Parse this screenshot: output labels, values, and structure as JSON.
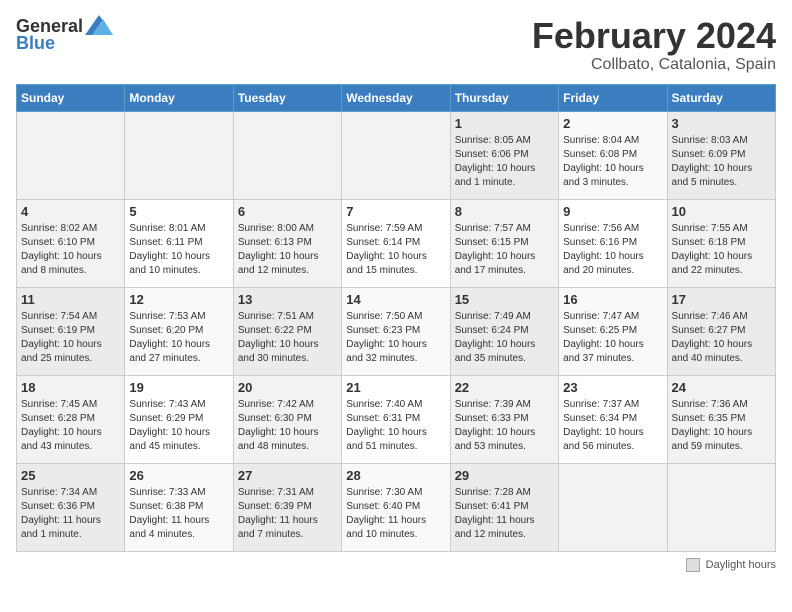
{
  "header": {
    "logo_general": "General",
    "logo_blue": "Blue",
    "month_title": "February 2024",
    "location": "Collbato, Catalonia, Spain"
  },
  "days_of_week": [
    "Sunday",
    "Monday",
    "Tuesday",
    "Wednesday",
    "Thursday",
    "Friday",
    "Saturday"
  ],
  "legend": {
    "label": "Daylight hours"
  },
  "weeks": [
    [
      {
        "day": "",
        "info": ""
      },
      {
        "day": "",
        "info": ""
      },
      {
        "day": "",
        "info": ""
      },
      {
        "day": "",
        "info": ""
      },
      {
        "day": "1",
        "info": "Sunrise: 8:05 AM\nSunset: 6:06 PM\nDaylight: 10 hours\nand 1 minute."
      },
      {
        "day": "2",
        "info": "Sunrise: 8:04 AM\nSunset: 6:08 PM\nDaylight: 10 hours\nand 3 minutes."
      },
      {
        "day": "3",
        "info": "Sunrise: 8:03 AM\nSunset: 6:09 PM\nDaylight: 10 hours\nand 5 minutes."
      }
    ],
    [
      {
        "day": "4",
        "info": "Sunrise: 8:02 AM\nSunset: 6:10 PM\nDaylight: 10 hours\nand 8 minutes."
      },
      {
        "day": "5",
        "info": "Sunrise: 8:01 AM\nSunset: 6:11 PM\nDaylight: 10 hours\nand 10 minutes."
      },
      {
        "day": "6",
        "info": "Sunrise: 8:00 AM\nSunset: 6:13 PM\nDaylight: 10 hours\nand 12 minutes."
      },
      {
        "day": "7",
        "info": "Sunrise: 7:59 AM\nSunset: 6:14 PM\nDaylight: 10 hours\nand 15 minutes."
      },
      {
        "day": "8",
        "info": "Sunrise: 7:57 AM\nSunset: 6:15 PM\nDaylight: 10 hours\nand 17 minutes."
      },
      {
        "day": "9",
        "info": "Sunrise: 7:56 AM\nSunset: 6:16 PM\nDaylight: 10 hours\nand 20 minutes."
      },
      {
        "day": "10",
        "info": "Sunrise: 7:55 AM\nSunset: 6:18 PM\nDaylight: 10 hours\nand 22 minutes."
      }
    ],
    [
      {
        "day": "11",
        "info": "Sunrise: 7:54 AM\nSunset: 6:19 PM\nDaylight: 10 hours\nand 25 minutes."
      },
      {
        "day": "12",
        "info": "Sunrise: 7:53 AM\nSunset: 6:20 PM\nDaylight: 10 hours\nand 27 minutes."
      },
      {
        "day": "13",
        "info": "Sunrise: 7:51 AM\nSunset: 6:22 PM\nDaylight: 10 hours\nand 30 minutes."
      },
      {
        "day": "14",
        "info": "Sunrise: 7:50 AM\nSunset: 6:23 PM\nDaylight: 10 hours\nand 32 minutes."
      },
      {
        "day": "15",
        "info": "Sunrise: 7:49 AM\nSunset: 6:24 PM\nDaylight: 10 hours\nand 35 minutes."
      },
      {
        "day": "16",
        "info": "Sunrise: 7:47 AM\nSunset: 6:25 PM\nDaylight: 10 hours\nand 37 minutes."
      },
      {
        "day": "17",
        "info": "Sunrise: 7:46 AM\nSunset: 6:27 PM\nDaylight: 10 hours\nand 40 minutes."
      }
    ],
    [
      {
        "day": "18",
        "info": "Sunrise: 7:45 AM\nSunset: 6:28 PM\nDaylight: 10 hours\nand 43 minutes."
      },
      {
        "day": "19",
        "info": "Sunrise: 7:43 AM\nSunset: 6:29 PM\nDaylight: 10 hours\nand 45 minutes."
      },
      {
        "day": "20",
        "info": "Sunrise: 7:42 AM\nSunset: 6:30 PM\nDaylight: 10 hours\nand 48 minutes."
      },
      {
        "day": "21",
        "info": "Sunrise: 7:40 AM\nSunset: 6:31 PM\nDaylight: 10 hours\nand 51 minutes."
      },
      {
        "day": "22",
        "info": "Sunrise: 7:39 AM\nSunset: 6:33 PM\nDaylight: 10 hours\nand 53 minutes."
      },
      {
        "day": "23",
        "info": "Sunrise: 7:37 AM\nSunset: 6:34 PM\nDaylight: 10 hours\nand 56 minutes."
      },
      {
        "day": "24",
        "info": "Sunrise: 7:36 AM\nSunset: 6:35 PM\nDaylight: 10 hours\nand 59 minutes."
      }
    ],
    [
      {
        "day": "25",
        "info": "Sunrise: 7:34 AM\nSunset: 6:36 PM\nDaylight: 11 hours\nand 1 minute."
      },
      {
        "day": "26",
        "info": "Sunrise: 7:33 AM\nSunset: 6:38 PM\nDaylight: 11 hours\nand 4 minutes."
      },
      {
        "day": "27",
        "info": "Sunrise: 7:31 AM\nSunset: 6:39 PM\nDaylight: 11 hours\nand 7 minutes."
      },
      {
        "day": "28",
        "info": "Sunrise: 7:30 AM\nSunset: 6:40 PM\nDaylight: 11 hours\nand 10 minutes."
      },
      {
        "day": "29",
        "info": "Sunrise: 7:28 AM\nSunset: 6:41 PM\nDaylight: 11 hours\nand 12 minutes."
      },
      {
        "day": "",
        "info": ""
      },
      {
        "day": "",
        "info": ""
      }
    ]
  ]
}
